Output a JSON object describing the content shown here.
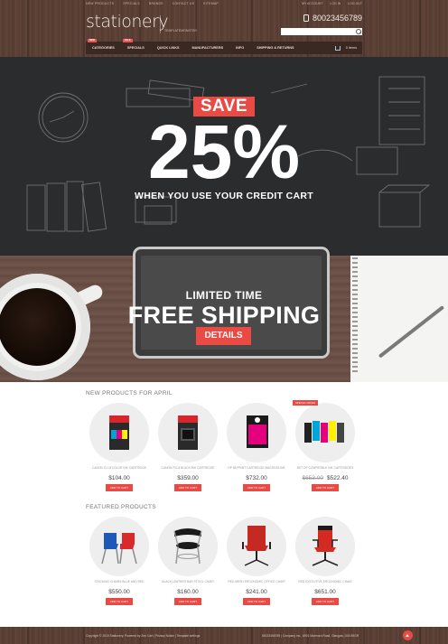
{
  "header": {
    "top_links": [
      "NEW PRODUCTS",
      "SPECIALS",
      "BRANDS",
      "CONTACT US",
      "SITEMAP"
    ],
    "account_links": [
      "MY ACCOUNT",
      "LOG IN",
      "LOG OUT"
    ],
    "logo": "stationery",
    "tagline": "TEMPLATEMONSTER",
    "phone": "80023456789",
    "search_placeholder": ""
  },
  "nav": {
    "items": [
      {
        "label": "CATEGORIES",
        "badge": "NEW"
      },
      {
        "label": "SPECIALS",
        "badge": "SALE"
      },
      {
        "label": "QUICK LINKS",
        "badge": ""
      },
      {
        "label": "MANUFACTURERS",
        "badge": ""
      },
      {
        "label": "INFO",
        "badge": ""
      },
      {
        "label": "SHIPPING & RETURNS",
        "badge": ""
      }
    ],
    "cart": "0 items"
  },
  "banner1": {
    "save": "SAVE",
    "percent": "25%",
    "subtitle": "WHEN YOU USE YOUR CREDIT CART"
  },
  "banner2": {
    "line1": "LIMITED TIME",
    "line2": "FREE SHIPPING",
    "button": "DETAILS"
  },
  "new_products": {
    "title": "NEW PRODUCTS FOR APRIL",
    "items": [
      {
        "name": "CANON CLI-8 COLOR INK CARTRIDGE",
        "price": "$104.00",
        "old_price": "",
        "button": "ADD TO CART",
        "tag": ""
      },
      {
        "name": "CANON PG-5 BLACK INK CARTRIDGE",
        "price": "$359.00",
        "old_price": "",
        "button": "ADD TO CART",
        "tag": ""
      },
      {
        "name": "HP 88 PRINT CARTRIDGE MAGENTA INK",
        "price": "$732.00",
        "old_price": "",
        "button": "ADD TO CART",
        "tag": ""
      },
      {
        "name": "SET OF COMPATIBLE INK CARTRIDGES",
        "price": "$522.40",
        "old_price": "$653.00",
        "button": "ADD TO CART",
        "tag": "SPECIAL OFFER"
      }
    ]
  },
  "featured_products": {
    "title": "FEATURED PRODUCTS",
    "items": [
      {
        "name": "STACKING CHAIRS BLUE AND RED",
        "price": "$550.00",
        "button": "ADD TO CART"
      },
      {
        "name": "BLACK LEATHER BAR STOOL CHAIR",
        "price": "$160.00",
        "button": "ADD TO CART"
      },
      {
        "name": "RED MESH ERGONOMIC OFFICE CHAIR",
        "price": "$241.00",
        "button": "ADD TO CART"
      },
      {
        "name": "RED EXECUTIVE ERGONOMIC CHAIR",
        "price": "$651.00",
        "button": "ADD TO CART"
      }
    ]
  },
  "footer": {
    "copyright": "Copyright © 2015 Stationery. Powered by Zen Cart  |  Privacy Notice  |  Template settings",
    "address": "80023456789  |  Company Inc., 8901 Marmora Road, Glasgow, D04 89GR"
  },
  "colors": {
    "accent": "#e94a44",
    "wood": "#5a3e33",
    "chalkboard": "#2b2c2e"
  }
}
